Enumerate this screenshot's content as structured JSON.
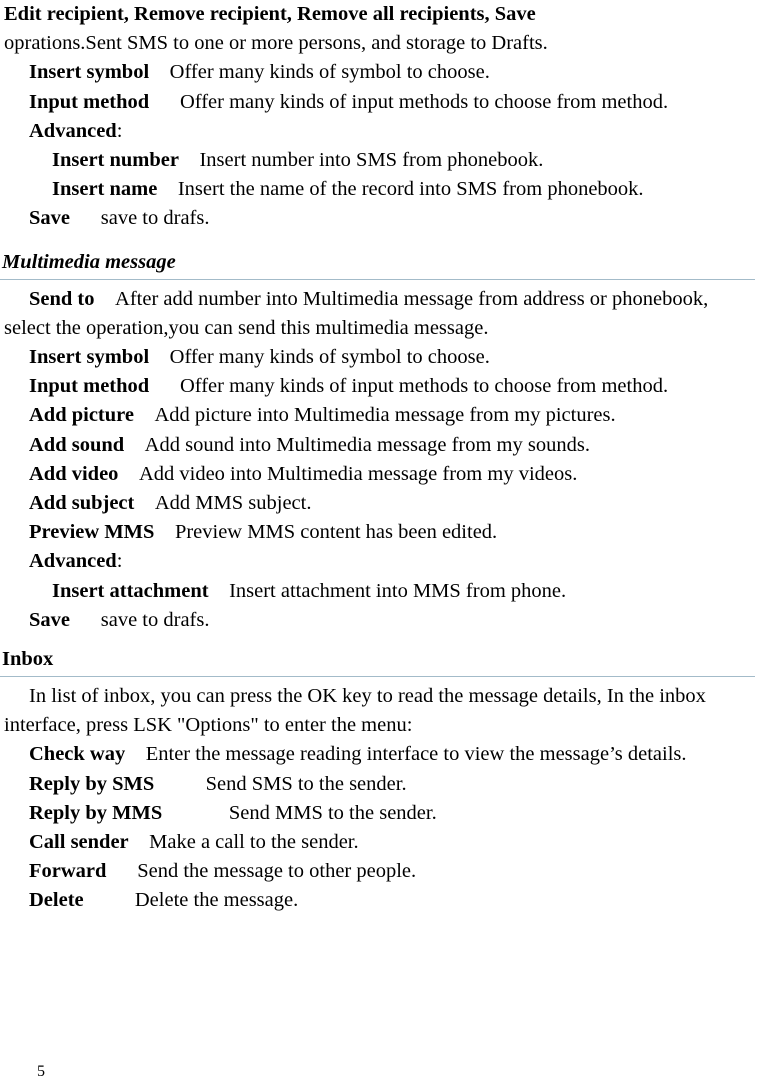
{
  "document": {
    "page_number": "5",
    "rule_color": "#a3bbc9"
  },
  "sms_section": {
    "intro": {
      "bold_lead": "Edit recipient, Remove recipient, Remove all recipients, Save",
      "rest": "oprations.Sent SMS to one or more persons, and storage to Drafts."
    },
    "items": [
      {
        "term": "Insert symbol",
        "desc": "Offer many kinds of symbol to choose."
      },
      {
        "term": "Input method",
        "desc": "Offer many kinds of input methods to choose from method."
      },
      {
        "term": "Advanced",
        "desc": ":"
      },
      {
        "term": "Insert number",
        "desc": "Insert number into SMS from phonebook."
      },
      {
        "term": "Insert name",
        "desc": "Insert the name of the record into SMS from phonebook."
      },
      {
        "term": "Save",
        "desc": "save to drafs."
      }
    ]
  },
  "multimedia_section": {
    "heading": "Multimedia message",
    "items": [
      {
        "term": "Send to",
        "desc": "After add number into Multimedia message from address or phonebook, select the operation,you can send this multimedia message."
      },
      {
        "term": "Insert symbol",
        "desc": "Offer many kinds of symbol to choose."
      },
      {
        "term": "Input method",
        "desc": "Offer many kinds of input methods to choose from method."
      },
      {
        "term": "Add picture",
        "desc": "Add picture into Multimedia message from my pictures."
      },
      {
        "term": "Add sound",
        "desc": "Add sound into Multimedia message from my sounds."
      },
      {
        "term": "Add video",
        "desc": "Add video into Multimedia message from my videos."
      },
      {
        "term": "Add subject",
        "desc": "Add MMS subject."
      },
      {
        "term": "Preview MMS",
        "desc": "Preview MMS content has been edited."
      },
      {
        "term": "Advanced",
        "desc": ":"
      },
      {
        "term": "Insert attachment",
        "desc": "Insert attachment into MMS from phone."
      },
      {
        "term": "Save",
        "desc": "save to drafs."
      }
    ]
  },
  "inbox_section": {
    "heading": "Inbox",
    "intro": "In list of inbox, you can press the OK key to read the message details, In the inbox interface, press LSK \"Options\" to enter the menu:",
    "items": [
      {
        "term": "Check way",
        "desc": "Enter the message reading interface to view the message’s details."
      },
      {
        "term": "Reply by SMS",
        "desc": "Send SMS to the sender."
      },
      {
        "term": "Reply by MMS",
        "desc": "Send MMS to the sender."
      },
      {
        "term": "Call sender",
        "desc": "Make a call to the sender."
      },
      {
        "term": "Forward",
        "desc": "Send the message to other people."
      },
      {
        "term": "Delete",
        "desc": "Delete the message."
      }
    ]
  }
}
